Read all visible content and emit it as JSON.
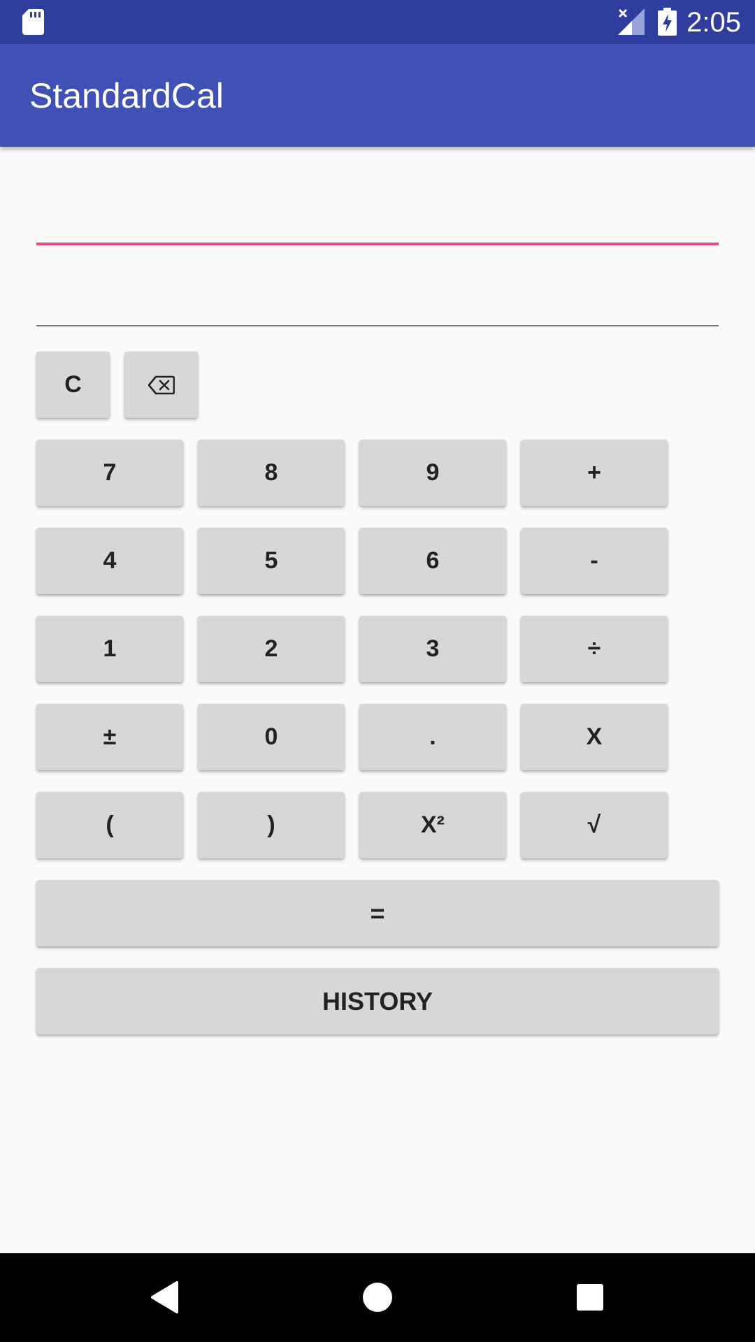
{
  "status_bar": {
    "time": "2:05",
    "icons": [
      "sd-card-icon",
      "signal-no-data-icon",
      "battery-charging-icon"
    ]
  },
  "app_bar": {
    "title": "StandardCal"
  },
  "display": {
    "expression_value": "",
    "result_value": ""
  },
  "keypad": {
    "clear": "C",
    "backspace_icon": "backspace-icon",
    "row1": [
      "7",
      "8",
      "9",
      "+"
    ],
    "row2": [
      "4",
      "5",
      "6",
      "-"
    ],
    "row3": [
      "1",
      "2",
      "3",
      "÷"
    ],
    "row4": [
      "±",
      "0",
      ".",
      "X"
    ],
    "row5": [
      "(",
      ")",
      "X²",
      "√"
    ],
    "equals": "=",
    "history": "HISTORY"
  },
  "nav_bar": {
    "icons": [
      "back-icon",
      "home-icon",
      "recents-icon"
    ]
  },
  "colors": {
    "status_bar": "#2f3e9e",
    "app_bar": "#3f51b5",
    "accent": "#f0468a",
    "button": "#d6d7d7",
    "background": "#fafafa"
  }
}
